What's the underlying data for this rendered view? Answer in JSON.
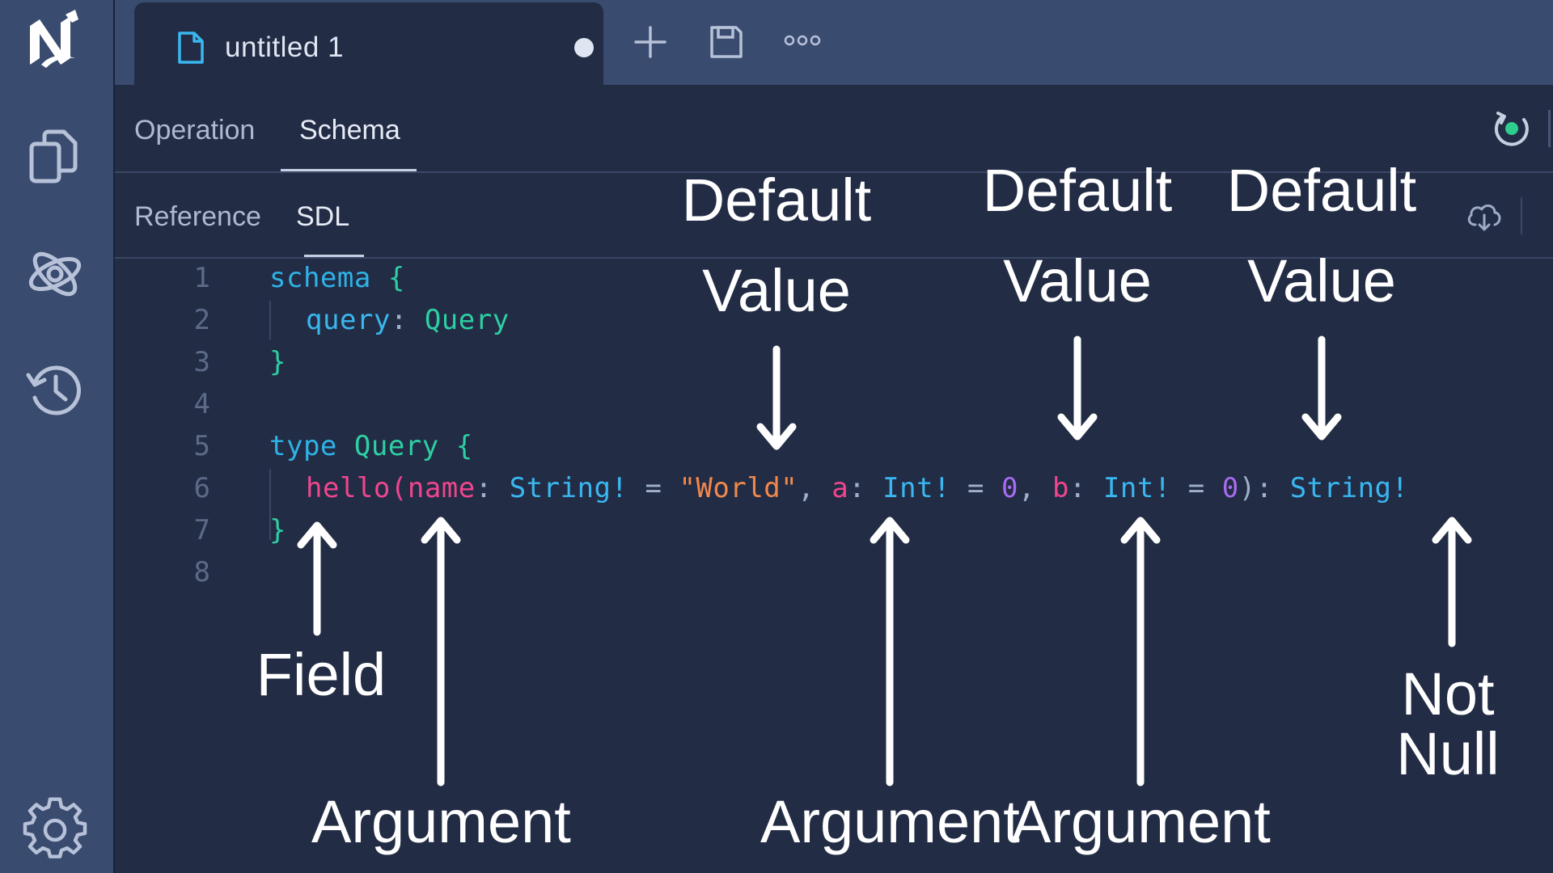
{
  "tab": {
    "title": "untitled 1"
  },
  "mode_tabs": {
    "operation": "Operation",
    "schema": "Schema"
  },
  "sub_tabs": {
    "reference": "Reference",
    "sdl": "SDL"
  },
  "line_numbers": [
    "1",
    "2",
    "3",
    "4",
    "5",
    "6",
    "7",
    "8"
  ],
  "code": {
    "l1_kw": "schema",
    "l1_brace": "{",
    "l2_field": "query",
    "l2_colon": ":",
    "l2_type": "Query",
    "l3_brace": "}",
    "l5_kw": "type",
    "l5_type": "Query",
    "l5_brace": "{",
    "l6": {
      "field": "hello",
      "paren_open": "(",
      "arg1": "name",
      "colon1": ":",
      "type1": "String!",
      "eq1": "=",
      "val1": "\"World\"",
      "comma1": ",",
      "arg2": "a",
      "colon2": ":",
      "type2": "Int!",
      "eq2": "=",
      "val2": "0",
      "comma2": ",",
      "arg3": "b",
      "colon3": ":",
      "type3": "Int!",
      "eq3": "=",
      "val3": "0",
      "paren_close": ")",
      "colon4": ":",
      "return_type": "String!"
    },
    "l7_brace": "}"
  },
  "annotations": {
    "default_value_1": [
      "Default",
      "Value"
    ],
    "default_value_2": [
      "Default",
      "Value"
    ],
    "default_value_3": [
      "Default",
      "Value"
    ],
    "field": "Field",
    "argument_1": "Argument",
    "argument_2": "Argument",
    "argument_3": "Argument",
    "not_null": "Not Null"
  },
  "colors": {
    "keyword": "#2fb2e6",
    "type": "#2dcfa3",
    "field": "#f0468e",
    "string": "#f2884b",
    "number": "#a86cf0",
    "status": "#2ecc8e"
  },
  "icons": {
    "logo": "logo-icon",
    "documents": "documents-icon",
    "graphql": "atom-icon",
    "history": "history-icon",
    "settings": "gear-icon",
    "file": "file-icon",
    "new_tab": "plus-icon",
    "save": "save-icon",
    "more": "more-icon",
    "refresh": "refresh-icon",
    "cloud": "cloud-download-icon"
  }
}
